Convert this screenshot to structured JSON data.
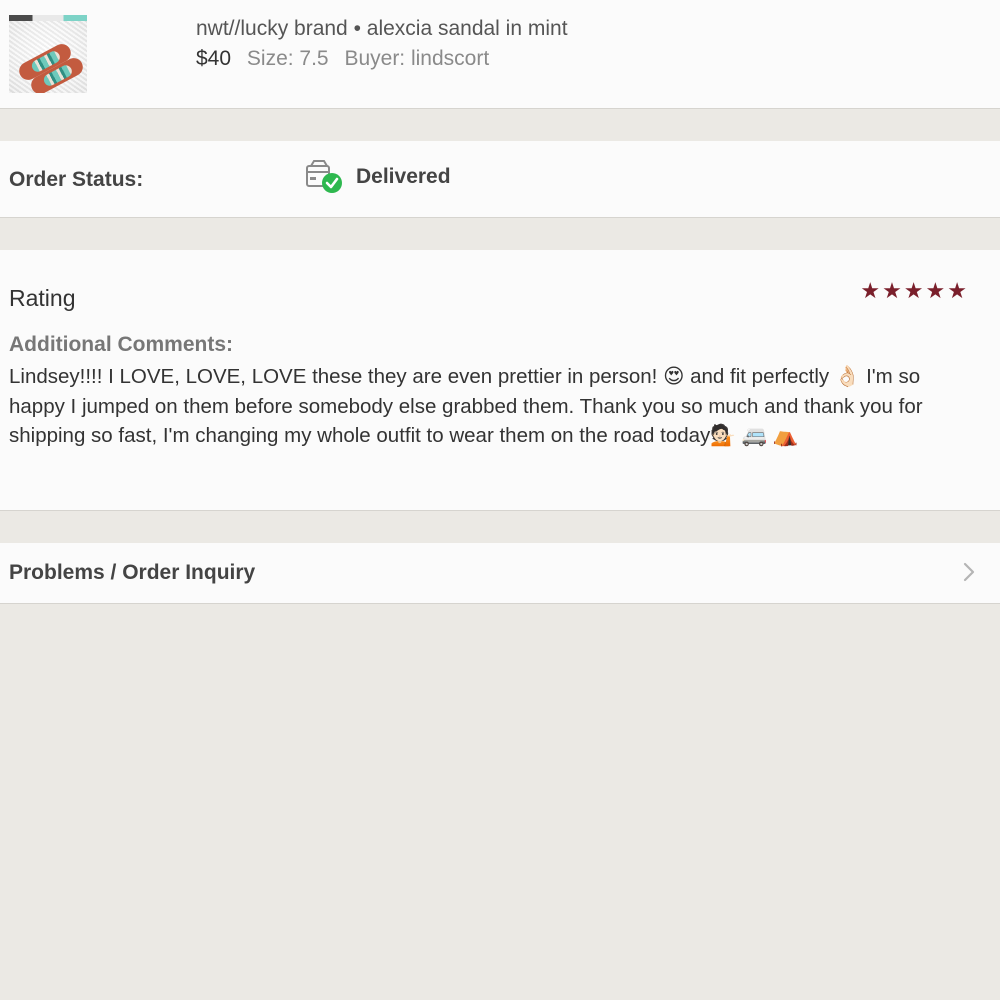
{
  "item": {
    "title": "nwt//lucky brand • alexcia sandal in mint",
    "price": "$40",
    "size": "Size: 7.5",
    "buyer": "Buyer: lindscort",
    "thumbnail_icon": "sandal-photo"
  },
  "order_status": {
    "label": "Order Status:",
    "value": "Delivered",
    "icon": "delivered-box-icon",
    "check_color": "#2eb84f"
  },
  "rating": {
    "title": "Rating",
    "stars": 5,
    "max_stars": 5,
    "star_glyph": "★",
    "star_color": "#7a1f2b",
    "comments_label": "Additional Comments:",
    "comment_text": "Lindsey!!!! I LOVE, LOVE, LOVE these they are even prettier in person! 😍 and fit perfectly 👌🏻 I'm so happy I jumped on them before somebody else grabbed them. Thank you so much and thank you for shipping so fast, I'm changing my whole outfit to wear them on the road today💁🏻 🚐 ⛺"
  },
  "problems": {
    "label": "Problems / Order Inquiry",
    "icon": "chevron-right-icon"
  }
}
